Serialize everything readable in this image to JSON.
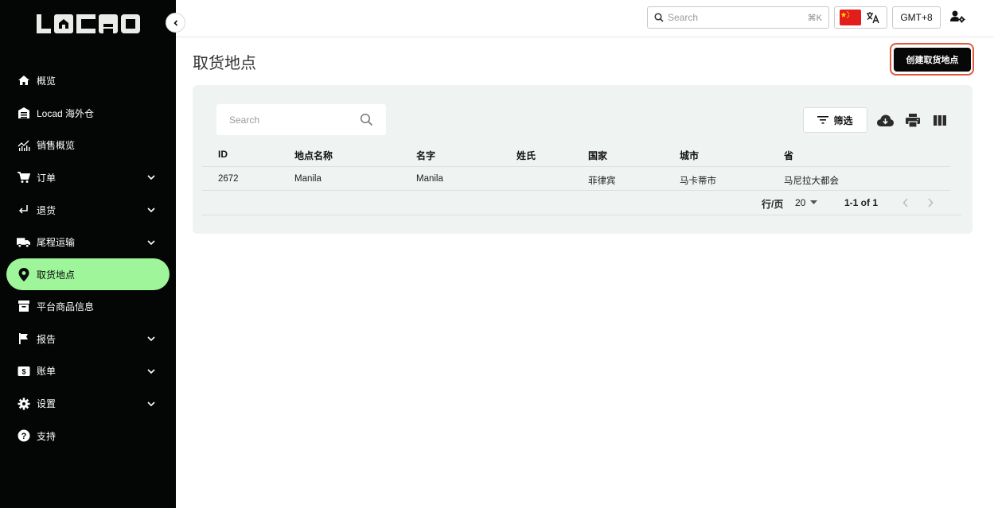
{
  "app": {
    "logo_text": "LOCAD"
  },
  "sidebar": {
    "items": [
      {
        "label": "概览",
        "icon": "home-icon",
        "expandable": false
      },
      {
        "label": "Locad 海外仓",
        "icon": "warehouse-icon",
        "expandable": false
      },
      {
        "label": "销售概览",
        "icon": "analytics-icon",
        "expandable": false
      },
      {
        "label": "订单",
        "icon": "cart-icon",
        "expandable": true
      },
      {
        "label": "退货",
        "icon": "return-icon",
        "expandable": true
      },
      {
        "label": "尾程运输",
        "icon": "truck-icon",
        "expandable": true
      },
      {
        "label": "取货地点",
        "icon": "location-pin-icon",
        "expandable": false,
        "active": true
      },
      {
        "label": "平台商品信息",
        "icon": "archive-icon",
        "expandable": false
      },
      {
        "label": "报告",
        "icon": "flag-icon",
        "expandable": true
      },
      {
        "label": "账单",
        "icon": "billing-icon",
        "expandable": true
      },
      {
        "label": "设置",
        "icon": "gear-icon",
        "expandable": true
      },
      {
        "label": "支持",
        "icon": "help-icon",
        "expandable": false
      }
    ],
    "active_color": "#9ef59a"
  },
  "topbar": {
    "search_placeholder": "Search",
    "search_shortcut": "⌘K",
    "timezone": "GMT+8"
  },
  "page": {
    "title": "取货地点",
    "create_button": "创建取货地点"
  },
  "table": {
    "search_placeholder": "Search",
    "filter_label": "筛选",
    "columns": [
      "ID",
      "地点名称",
      "名字",
      "姓氏",
      "国家",
      "城市",
      "省"
    ],
    "rows": [
      [
        "2672",
        "Manila",
        "Manila",
        "",
        "菲律宾",
        "马卡蒂市",
        "马尼拉大都会"
      ]
    ],
    "pagination": {
      "rows_per_page_label": "行/页",
      "rows_per_page": "20",
      "range": "1-1 of 1"
    }
  }
}
